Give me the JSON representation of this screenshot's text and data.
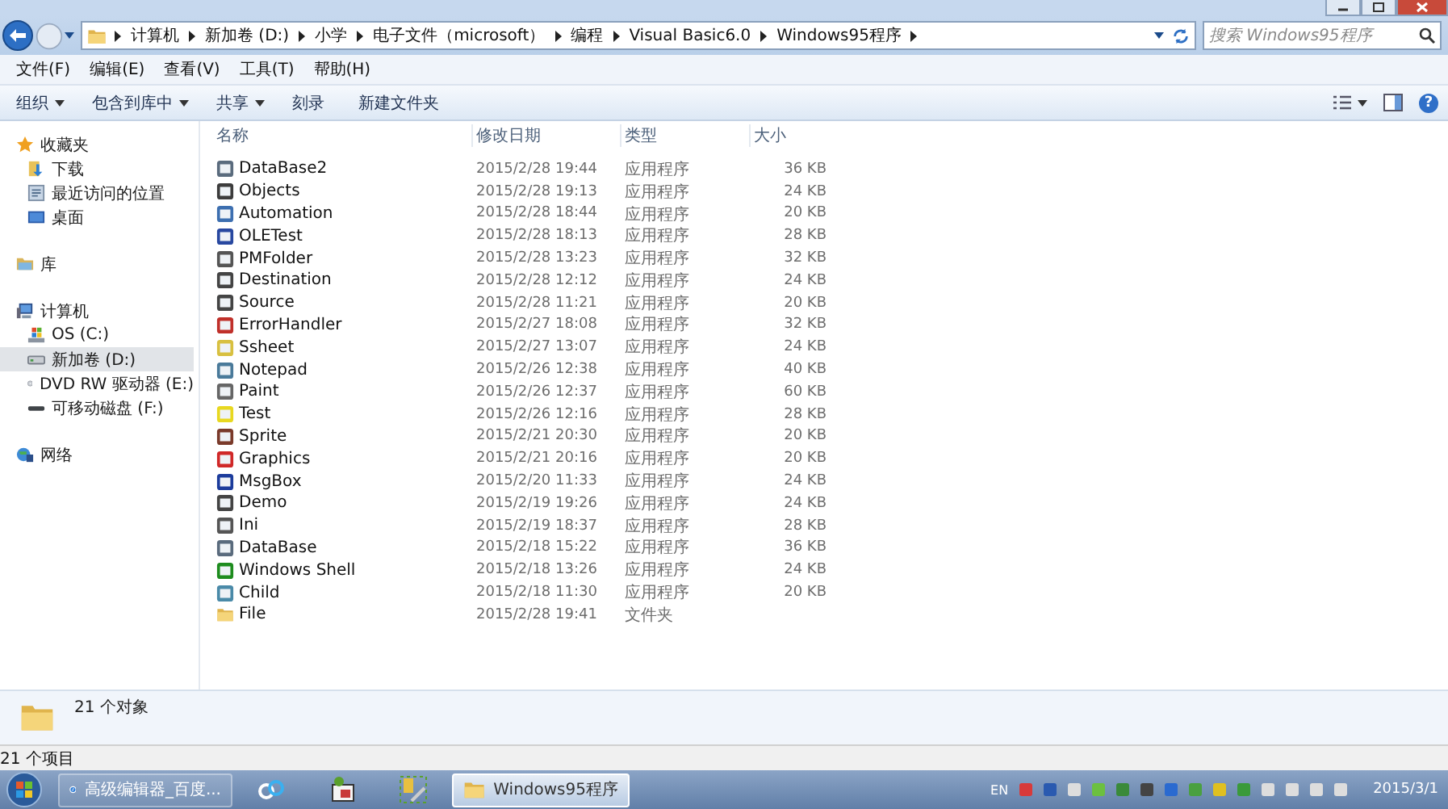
{
  "address": {
    "breadcrumbs": [
      "计算机",
      "新加卷 (D:)",
      "小学",
      "电子文件（microsoft）",
      "编程",
      "Visual Basic6.0",
      "Windows95程序"
    ]
  },
  "search": {
    "placeholder": "搜索 Windows95程序"
  },
  "menu": [
    "文件(F)",
    "编辑(E)",
    "查看(V)",
    "工具(T)",
    "帮助(H)"
  ],
  "toolbar": {
    "buttons": [
      {
        "label": "组织",
        "dropdown": true
      },
      {
        "label": "包含到库中",
        "dropdown": true
      },
      {
        "label": "共享",
        "dropdown": true
      },
      {
        "label": "刻录",
        "dropdown": false
      },
      {
        "label": "新建文件夹",
        "dropdown": false
      }
    ],
    "help": "?"
  },
  "sidebar": {
    "groups": [
      {
        "label": "收藏夹",
        "kind": "favorites",
        "selected": false,
        "children": [
          {
            "label": "下载",
            "kind": "downloads",
            "selected": false
          },
          {
            "label": "最近访问的位置",
            "kind": "recent",
            "selected": false
          },
          {
            "label": "桌面",
            "kind": "desktop",
            "selected": false
          }
        ]
      },
      {
        "label": "库",
        "kind": "library",
        "selected": false
      },
      {
        "label": "计算机",
        "kind": "computer",
        "selected": false,
        "children": [
          {
            "label": "OS (C:)",
            "kind": "system-drive",
            "selected": false
          },
          {
            "label": "新加卷 (D:)",
            "kind": "drive",
            "selected": true
          },
          {
            "label": "DVD RW 驱动器 (E:)",
            "kind": "dvd",
            "selected": false
          },
          {
            "label": "可移动磁盘 (F:)",
            "kind": "removable",
            "selected": false
          }
        ]
      },
      {
        "label": "网络",
        "kind": "network",
        "selected": false
      }
    ]
  },
  "table": {
    "columns": [
      "名称",
      "修改日期",
      "类型",
      "大小"
    ],
    "rows": [
      {
        "name": "DataBase2",
        "date": "2015/2/28 19:44",
        "type": "应用程序",
        "size": "36 KB",
        "kind": "app"
      },
      {
        "name": "Objects",
        "date": "2015/2/28 19:13",
        "type": "应用程序",
        "size": "24 KB",
        "kind": "app"
      },
      {
        "name": "Automation",
        "date": "2015/2/28 18:44",
        "type": "应用程序",
        "size": "20 KB",
        "kind": "app"
      },
      {
        "name": "OLETest",
        "date": "2015/2/28 18:13",
        "type": "应用程序",
        "size": "28 KB",
        "kind": "app"
      },
      {
        "name": "PMFolder",
        "date": "2015/2/28 13:23",
        "type": "应用程序",
        "size": "32 KB",
        "kind": "app"
      },
      {
        "name": "Destination",
        "date": "2015/2/28 12:12",
        "type": "应用程序",
        "size": "24 KB",
        "kind": "app"
      },
      {
        "name": "Source",
        "date": "2015/2/28 11:21",
        "type": "应用程序",
        "size": "20 KB",
        "kind": "app"
      },
      {
        "name": "ErrorHandler",
        "date": "2015/2/27 18:08",
        "type": "应用程序",
        "size": "32 KB",
        "kind": "app"
      },
      {
        "name": "Ssheet",
        "date": "2015/2/27 13:07",
        "type": "应用程序",
        "size": "24 KB",
        "kind": "app"
      },
      {
        "name": "Notepad",
        "date": "2015/2/26 12:38",
        "type": "应用程序",
        "size": "40 KB",
        "kind": "app"
      },
      {
        "name": "Paint",
        "date": "2015/2/26 12:37",
        "type": "应用程序",
        "size": "60 KB",
        "kind": "app"
      },
      {
        "name": "Test",
        "date": "2015/2/26 12:16",
        "type": "应用程序",
        "size": "28 KB",
        "kind": "app"
      },
      {
        "name": "Sprite",
        "date": "2015/2/21 20:30",
        "type": "应用程序",
        "size": "20 KB",
        "kind": "app"
      },
      {
        "name": "Graphics",
        "date": "2015/2/21 20:16",
        "type": "应用程序",
        "size": "20 KB",
        "kind": "app"
      },
      {
        "name": "MsgBox",
        "date": "2015/2/20 11:33",
        "type": "应用程序",
        "size": "24 KB",
        "kind": "app"
      },
      {
        "name": "Demo",
        "date": "2015/2/19 19:26",
        "type": "应用程序",
        "size": "24 KB",
        "kind": "app"
      },
      {
        "name": "Ini",
        "date": "2015/2/19 18:37",
        "type": "应用程序",
        "size": "28 KB",
        "kind": "app"
      },
      {
        "name": "DataBase",
        "date": "2015/2/18 15:22",
        "type": "应用程序",
        "size": "36 KB",
        "kind": "app"
      },
      {
        "name": "Windows Shell",
        "date": "2015/2/18 13:26",
        "type": "应用程序",
        "size": "24 KB",
        "kind": "app"
      },
      {
        "name": "Child",
        "date": "2015/2/18 11:30",
        "type": "应用程序",
        "size": "20 KB",
        "kind": "app"
      },
      {
        "name": "File",
        "date": "2015/2/28 19:41",
        "type": "文件夹",
        "kind": "folder"
      }
    ]
  },
  "details": {
    "count": "21 个对象"
  },
  "status_bar": "21 个项目",
  "taskbar": {
    "items": [
      {
        "label": "高级编辑器_百度...",
        "kind": "browser",
        "selected": false
      },
      {
        "kind": "cloud",
        "selected": false
      },
      {
        "kind": "paint",
        "selected": false
      },
      {
        "kind": "tools",
        "selected": false
      },
      {
        "label": "Windows95程序",
        "kind": "folder",
        "selected": true
      }
    ],
    "language": "EN",
    "date": "2015/3/1"
  }
}
